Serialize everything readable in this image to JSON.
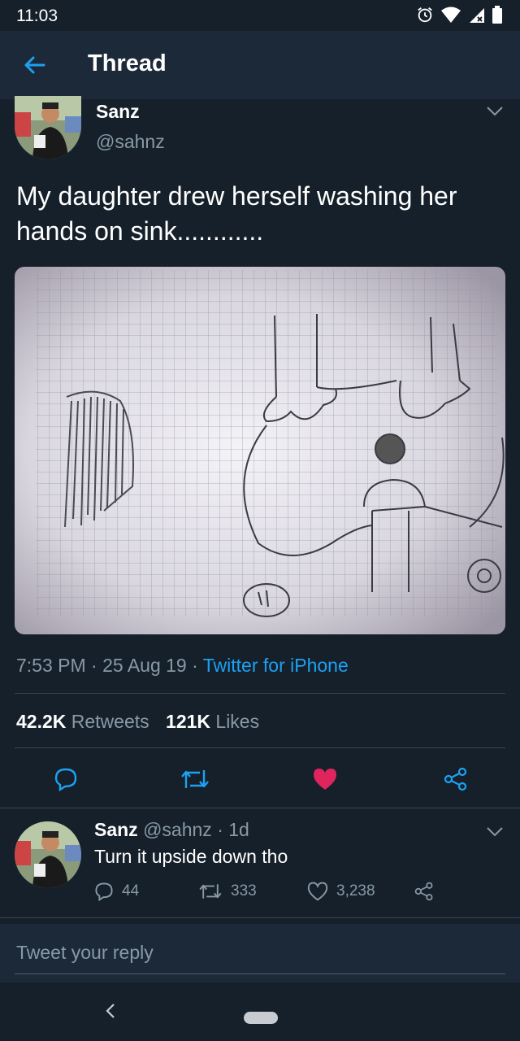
{
  "status_bar": {
    "time": "11:03"
  },
  "header": {
    "title": "Thread"
  },
  "tweet": {
    "display_name": "Sanz",
    "handle": "@sahnz",
    "text": "My daughter drew herself washing her hands on sink............",
    "time": "7:53 PM",
    "date": "25 Aug 19",
    "sep": "·",
    "source": "Twitter for iPhone",
    "retweets_count": "42.2K",
    "retweets_label": "Retweets",
    "likes_count": "121K",
    "likes_label": "Likes",
    "liked": true,
    "like_color": "#e0245e"
  },
  "reply": {
    "display_name": "Sanz",
    "handle": "@sahnz",
    "age": "1d",
    "sep": "·",
    "text": "Turn it upside down tho",
    "replies": "44",
    "retweets": "333",
    "likes": "3,238"
  },
  "composer": {
    "placeholder": "Tweet your reply"
  },
  "colors": {
    "background": "#15202b",
    "bar": "#1c2938",
    "muted": "#8899a6",
    "accent": "#1da1f2",
    "like": "#e0245e"
  },
  "icons": [
    "alarm-icon",
    "wifi-icon",
    "signal-icon",
    "battery-icon",
    "back-arrow-icon",
    "chevron-down-icon",
    "reply-icon",
    "retweet-icon",
    "heart-icon",
    "share-icon",
    "nav-back-icon",
    "home-pill"
  ]
}
